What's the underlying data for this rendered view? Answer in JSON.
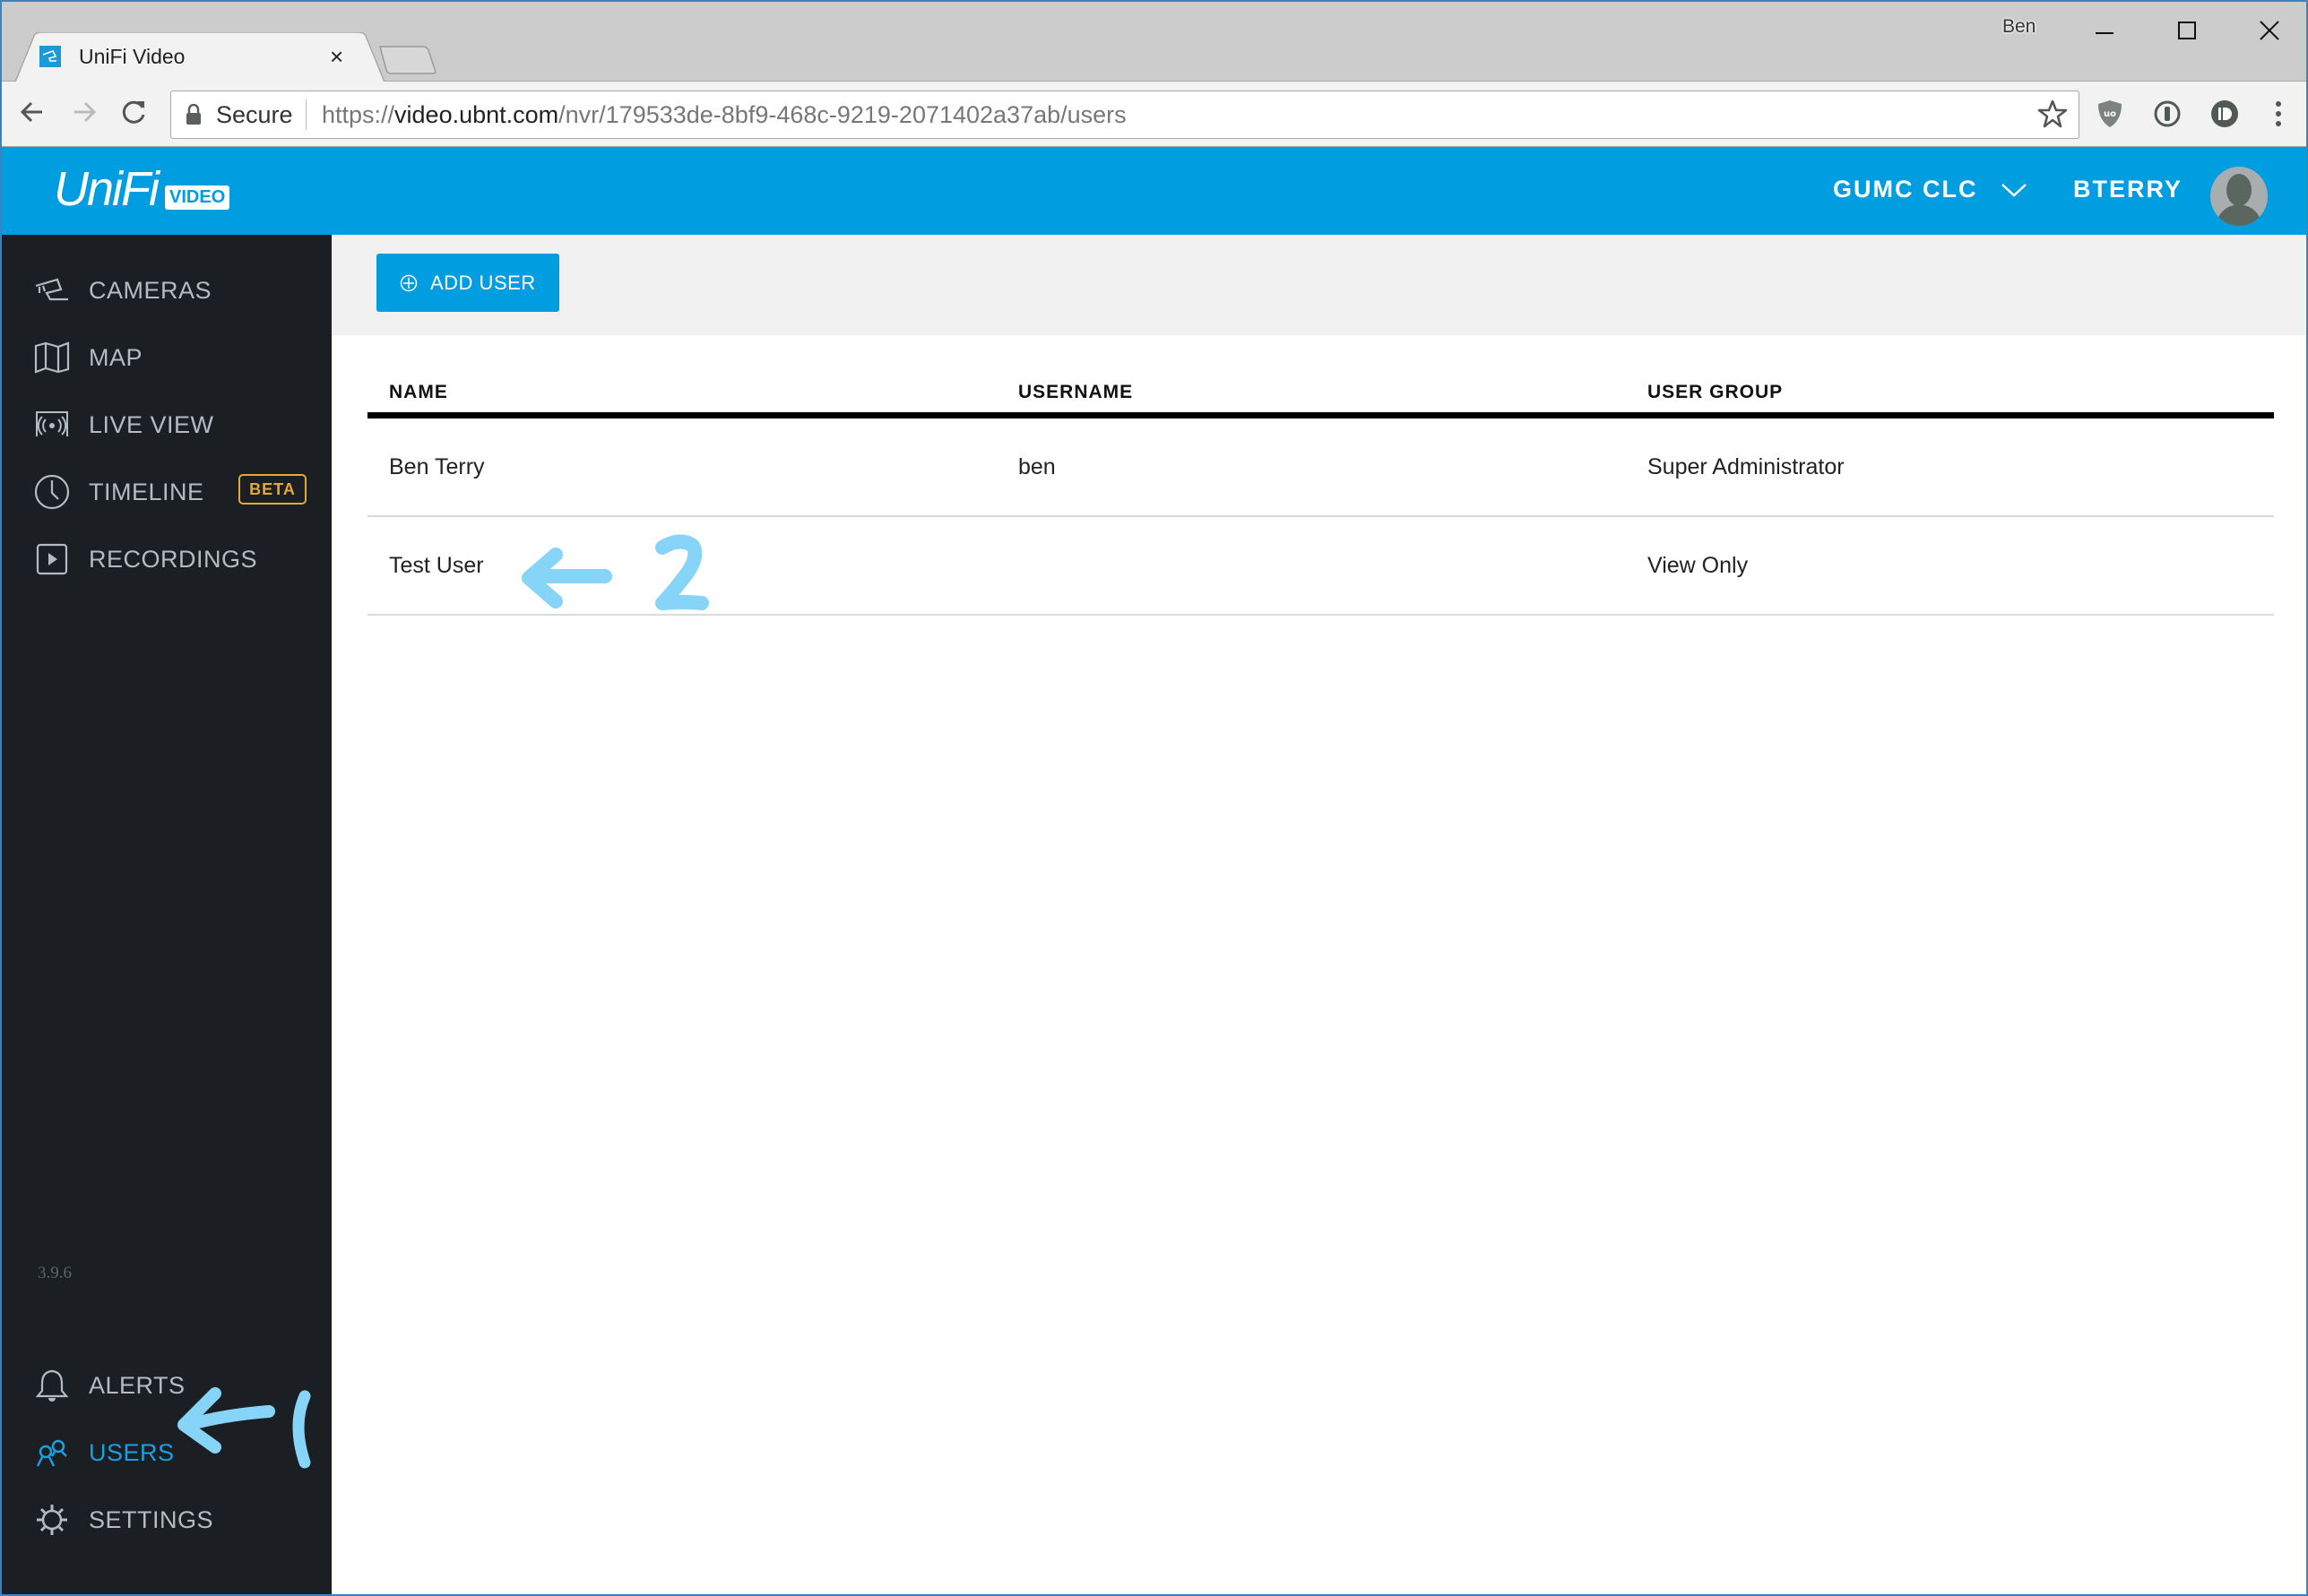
{
  "browser": {
    "tab_title": "UniFi Video",
    "profile_name": "Ben",
    "security_label": "Secure",
    "url_scheme": "https://",
    "url_host": "video.ubnt.com",
    "url_path": "/nvr/179533de-8bf9-468c-9219-2071402a37ab/users",
    "extensions": [
      "ublock-origin-icon",
      "1password-icon",
      "pushbullet-icon"
    ]
  },
  "header": {
    "logo_text": "UniFi",
    "logo_badge": "VIDEO",
    "site_name": "GUMC CLC",
    "account_name": "BTERRY",
    "brand_color": "#009de0"
  },
  "sidebar": {
    "items": [
      {
        "label": "CAMERAS",
        "icon": "camera-icon"
      },
      {
        "label": "MAP",
        "icon": "map-icon"
      },
      {
        "label": "LIVE VIEW",
        "icon": "live-view-icon"
      },
      {
        "label": "TIMELINE",
        "icon": "clock-icon",
        "badge": "BETA"
      },
      {
        "label": "RECORDINGS",
        "icon": "play-icon"
      }
    ],
    "version": "3.9.6",
    "bottom_items": [
      {
        "label": "ALERTS",
        "icon": "bell-icon"
      },
      {
        "label": "USERS",
        "icon": "users-icon",
        "active": true
      },
      {
        "label": "SETTINGS",
        "icon": "gear-icon"
      }
    ]
  },
  "main": {
    "add_user_label": "ADD USER",
    "table": {
      "columns": [
        "NAME",
        "USERNAME",
        "USER GROUP"
      ],
      "rows": [
        {
          "name": "Ben Terry",
          "username": "ben",
          "group": "Super Administrator"
        },
        {
          "name": "Test User",
          "username": "",
          "group": "View Only"
        }
      ]
    }
  },
  "annotations": {
    "step1": "1",
    "step2": "2",
    "color": "#86d4f7"
  }
}
